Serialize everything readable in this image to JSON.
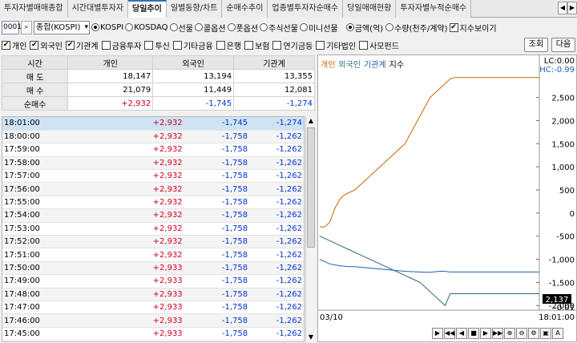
{
  "tabs": [
    {
      "label": "투자자별매매종합"
    },
    {
      "label": "시간대별투자자"
    },
    {
      "label": "당일추이",
      "active": true
    },
    {
      "label": "일별동향/차트"
    },
    {
      "label": "순매수추이"
    },
    {
      "label": "업종별투자자순매수"
    },
    {
      "label": "당일매매현황"
    },
    {
      "label": "투자자별누적순매수"
    }
  ],
  "tab_nav": {
    "prev": "◀",
    "next": "▶"
  },
  "controls": {
    "code": "0001",
    "market_select": "종합(KOSPI)",
    "market_radios": [
      {
        "label": "KOSPI",
        "checked": true
      },
      {
        "label": "KOSDAQ",
        "checked": false
      },
      {
        "label": "선물",
        "checked": false
      },
      {
        "label": "콜옵션",
        "checked": false
      },
      {
        "label": "풋옵션",
        "checked": false
      },
      {
        "label": "주식선물",
        "checked": false
      },
      {
        "label": "미니선물",
        "checked": false
      }
    ],
    "unit_radios": [
      {
        "label": "금액(억)",
        "checked": true
      },
      {
        "label": "수량(천주/계약)",
        "checked": false
      }
    ],
    "index_show_label": "지수보이기",
    "index_show_checked": true,
    "investor_checks": [
      {
        "label": "개인",
        "checked": true
      },
      {
        "label": "외국인",
        "checked": true
      },
      {
        "label": "기관계",
        "checked": true
      },
      {
        "label": "금융투자",
        "checked": false
      },
      {
        "label": "투신",
        "checked": false
      },
      {
        "label": "기타금융",
        "checked": false
      },
      {
        "label": "은행",
        "checked": false
      },
      {
        "label": "보험",
        "checked": false
      },
      {
        "label": "연기금등",
        "checked": false
      },
      {
        "label": "기타법인",
        "checked": false
      },
      {
        "label": "사모펀드",
        "checked": false
      }
    ],
    "search_button": "조회",
    "next_button": "다음"
  },
  "summary": {
    "headers": [
      "시간",
      "개인",
      "외국인",
      "기관계"
    ],
    "rows": [
      {
        "label": "매 도",
        "values": [
          "18,147",
          "13,194",
          "13,355"
        ],
        "color": [
          "",
          "",
          ""
        ]
      },
      {
        "label": "매 수",
        "values": [
          "21,079",
          "11,449",
          "12,081"
        ],
        "color": [
          "",
          "",
          ""
        ]
      },
      {
        "label": "순매수",
        "values": [
          "+2,932",
          "-1,745",
          "-1,274"
        ],
        "color": [
          "red",
          "blue",
          "blue"
        ]
      }
    ]
  },
  "grid": {
    "rows": [
      [
        "18:01:00",
        "+2,932",
        "-1,745",
        "-1,274"
      ],
      [
        "18:00:00",
        "+2,932",
        "-1,758",
        "-1,262"
      ],
      [
        "17:59:00",
        "+2,932",
        "-1,758",
        "-1,262"
      ],
      [
        "17:58:00",
        "+2,932",
        "-1,758",
        "-1,262"
      ],
      [
        "17:57:00",
        "+2,932",
        "-1,758",
        "-1,262"
      ],
      [
        "17:56:00",
        "+2,932",
        "-1,758",
        "-1,262"
      ],
      [
        "17:55:00",
        "+2,932",
        "-1,758",
        "-1,262"
      ],
      [
        "17:54:00",
        "+2,932",
        "-1,758",
        "-1,262"
      ],
      [
        "17:53:00",
        "+2,932",
        "-1,758",
        "-1,262"
      ],
      [
        "17:52:00",
        "+2,932",
        "-1,758",
        "-1,262"
      ],
      [
        "17:51:00",
        "+2,932",
        "-1,758",
        "-1,262"
      ],
      [
        "17:50:00",
        "+2,933",
        "-1,758",
        "-1,262"
      ],
      [
        "17:49:00",
        "+2,933",
        "-1,758",
        "-1,262"
      ],
      [
        "17:48:00",
        "+2,933",
        "-1,758",
        "-1,262"
      ],
      [
        "17:47:00",
        "+2,933",
        "-1,758",
        "-1,262"
      ],
      [
        "17:46:00",
        "+2,933",
        "-1,758",
        "-1,262"
      ],
      [
        "17:45:00",
        "+2,933",
        "-1,758",
        "-1,262"
      ]
    ]
  },
  "chart": {
    "legend": [
      {
        "label": "개인",
        "color": "#c86400"
      },
      {
        "label": "외국인",
        "color": "#2a6b7a"
      },
      {
        "label": "기관계",
        "color": "#2060b0"
      },
      {
        "label": "지수",
        "color": "#000000"
      }
    ],
    "y_ticks": [
      "2,500",
      "2,000",
      "1,500",
      "1,000",
      "500",
      "0",
      "-500",
      "-1,000",
      "-1,500",
      "-2,000"
    ],
    "lc_label": "LC:0.00",
    "hc_label": "HC:-0.99",
    "last_value": "2,137",
    "low_label": "-0.01",
    "date_label": "03/10",
    "time_label": "18:01:00"
  },
  "chart_data": {
    "type": "line",
    "ylim": [
      -2100,
      3100
    ],
    "series": [
      {
        "name": "개인",
        "values": [
          -300,
          -300,
          -200,
          100,
          300,
          400,
          450,
          500,
          600,
          700,
          800,
          900,
          1000,
          1100,
          1200,
          1300,
          1400,
          1500,
          1700,
          1900,
          2100,
          2300,
          2500,
          2600,
          2700,
          2800,
          2900,
          2932,
          2932,
          2932,
          2932,
          2932
        ]
      },
      {
        "name": "외국인",
        "values": [
          -500,
          -550,
          -600,
          -650,
          -700,
          -750,
          -800,
          -850,
          -900,
          -950,
          -1000,
          -1050,
          -1100,
          -1150,
          -1200,
          -1250,
          -1300,
          -1350,
          -1400,
          -1450,
          -1500,
          -1600,
          -1700,
          -1800,
          -1900,
          -2000,
          -1745,
          -1745,
          -1745,
          -1745,
          -1745,
          -1745
        ]
      },
      {
        "name": "기관계",
        "values": [
          -1000,
          -1050,
          -1100,
          -1120,
          -1140,
          -1150,
          -1160,
          -1160,
          -1170,
          -1180,
          -1190,
          -1200,
          -1210,
          -1220,
          -1230,
          -1240,
          -1250,
          -1260,
          -1265,
          -1270,
          -1275,
          -1280,
          -1280,
          -1270,
          -1260,
          -1262,
          -1274,
          -1274,
          -1274,
          -1274,
          -1274,
          -1274
        ]
      }
    ]
  }
}
